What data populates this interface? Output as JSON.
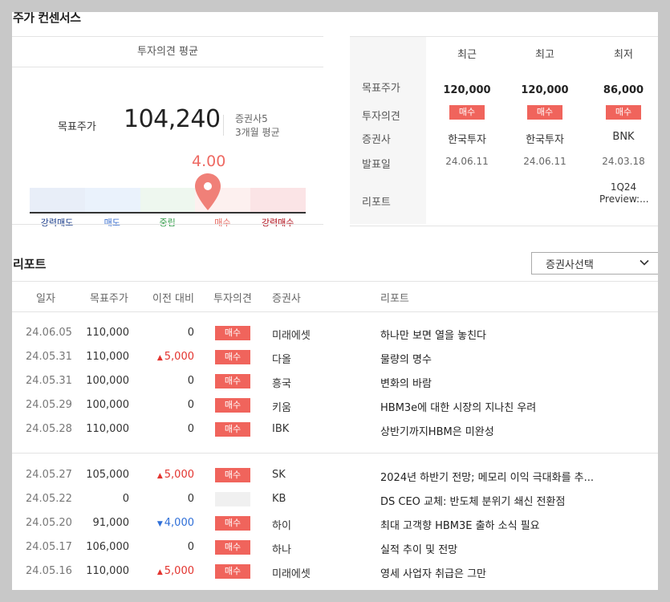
{
  "consensus": {
    "title": "주가 컨센서스",
    "avg_header": "투자의견 평균",
    "target_label": "목표주가",
    "target_value": "104,240",
    "brokers_count": "증권사5",
    "period": "3개월 평균",
    "score": "4.00",
    "score_fraction": 0.75,
    "scale": [
      {
        "label": "강력매도",
        "color": "#1a3c8a",
        "bg": "#e8eef8"
      },
      {
        "label": "매도",
        "color": "#3a6fd0",
        "bg": "#eaf2fc"
      },
      {
        "label": "중립",
        "color": "#2e9a45",
        "bg": "#eef7ef"
      },
      {
        "label": "매수",
        "color": "#e66a62",
        "bg": "#fdf0ef"
      },
      {
        "label": "강력매수",
        "color": "#b00f1b",
        "bg": "#fbe4e6"
      }
    ]
  },
  "summary": {
    "columns": [
      "최근",
      "최고",
      "최저"
    ],
    "row_labels": [
      "목표주가",
      "투자의견",
      "증권사",
      "발표일",
      "리포트"
    ],
    "cells": [
      {
        "target": "120,000",
        "opinion": "매수",
        "broker": "한국투자",
        "date": "24.06.11",
        "report": ""
      },
      {
        "target": "120,000",
        "opinion": "매수",
        "broker": "한국투자",
        "date": "24.06.11",
        "report": ""
      },
      {
        "target": "86,000",
        "opinion": "매수",
        "broker": "BNK",
        "date": "24.03.18",
        "report": "1Q24 Preview:..."
      }
    ]
  },
  "reports": {
    "title": "리포트",
    "broker_select": "증권사선택",
    "headers": {
      "date": "일자",
      "price": "목표주가",
      "change": "이전 대비",
      "opinion": "투자의견",
      "broker": "증권사",
      "report": "리포트"
    },
    "rows": [
      {
        "date": "24.06.05",
        "price": "110,000",
        "change": "0",
        "dir": "",
        "opinion": "매수",
        "broker": "미래에셋",
        "title": "하나만 보면 열을 놓친다"
      },
      {
        "date": "24.05.31",
        "price": "110,000",
        "change": "5,000",
        "dir": "up",
        "opinion": "매수",
        "broker": "다올",
        "title": "물량의 명수"
      },
      {
        "date": "24.05.31",
        "price": "100,000",
        "change": "0",
        "dir": "",
        "opinion": "매수",
        "broker": "흥국",
        "title": "변화의 바람"
      },
      {
        "date": "24.05.29",
        "price": "100,000",
        "change": "0",
        "dir": "",
        "opinion": "매수",
        "broker": "키움",
        "title": "HBM3e에 대한 시장의 지나친 우려"
      },
      {
        "date": "24.05.28",
        "price": "110,000",
        "change": "0",
        "dir": "",
        "opinion": "매수",
        "broker": "IBK",
        "title": "상반기까지HBM은 미완성"
      },
      {
        "date": "24.05.27",
        "price": "105,000",
        "change": "5,000",
        "dir": "up",
        "opinion": "매수",
        "broker": "SK",
        "title": "2024년 하반기 전망; 메모리 이익 극대화를 추..."
      },
      {
        "date": "24.05.22",
        "price": "0",
        "change": "0",
        "dir": "",
        "opinion": "",
        "broker": "KB",
        "title": "DS CEO 교체: 반도체 분위기 쇄신 전환점"
      },
      {
        "date": "24.05.20",
        "price": "91,000",
        "change": "4,000",
        "dir": "down",
        "opinion": "매수",
        "broker": "하이",
        "title": "최대 고객향 HBM3E 출하 소식 필요"
      },
      {
        "date": "24.05.17",
        "price": "106,000",
        "change": "0",
        "dir": "",
        "opinion": "매수",
        "broker": "하나",
        "title": "실적 추이 및 전망"
      },
      {
        "date": "24.05.16",
        "price": "110,000",
        "change": "5,000",
        "dir": "up",
        "opinion": "매수",
        "broker": "미래에셋",
        "title": "영세 사업자 취급은 그만"
      }
    ]
  }
}
